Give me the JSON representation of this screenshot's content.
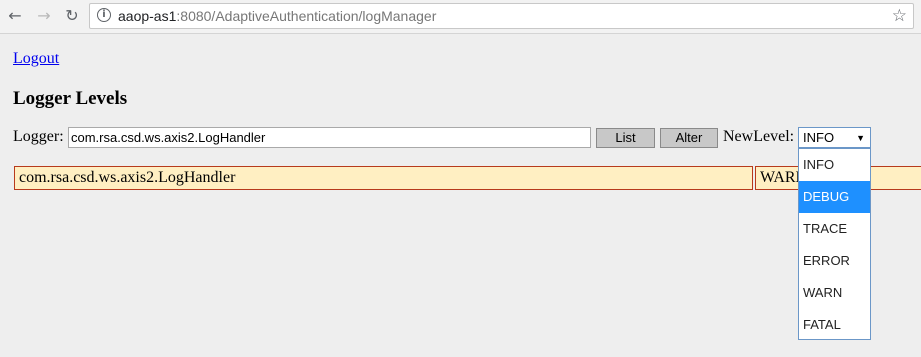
{
  "browser": {
    "url_host": "aaop-as1",
    "url_rest": ":8080/AdaptiveAuthentication/logManager",
    "icons": {
      "back": "arrow-left",
      "forward": "arrow-right",
      "reload": "reload",
      "info": "info",
      "bookmark": "star"
    }
  },
  "page": {
    "logout_label": "Logout",
    "title": "Logger Levels",
    "logger_label": "Logger:",
    "logger_value": "com.rsa.csd.ws.axis2.LogHandler",
    "list_button": "List",
    "alter_button": "Alter",
    "newlevel_label": "NewLevel:",
    "newlevel_selected": "INFO",
    "newlevel_options": [
      "INFO",
      "DEBUG",
      "TRACE",
      "ERROR",
      "WARN",
      "FATAL"
    ],
    "highlighted_option": "DEBUG",
    "result_row": {
      "logger": "com.rsa.csd.ws.axis2.LogHandler",
      "level": "WARN"
    }
  },
  "colors": {
    "row_background": "#ffefc2",
    "row_border": "#b73a1c",
    "highlight": "#1e90ff",
    "link": "#0000ee"
  }
}
